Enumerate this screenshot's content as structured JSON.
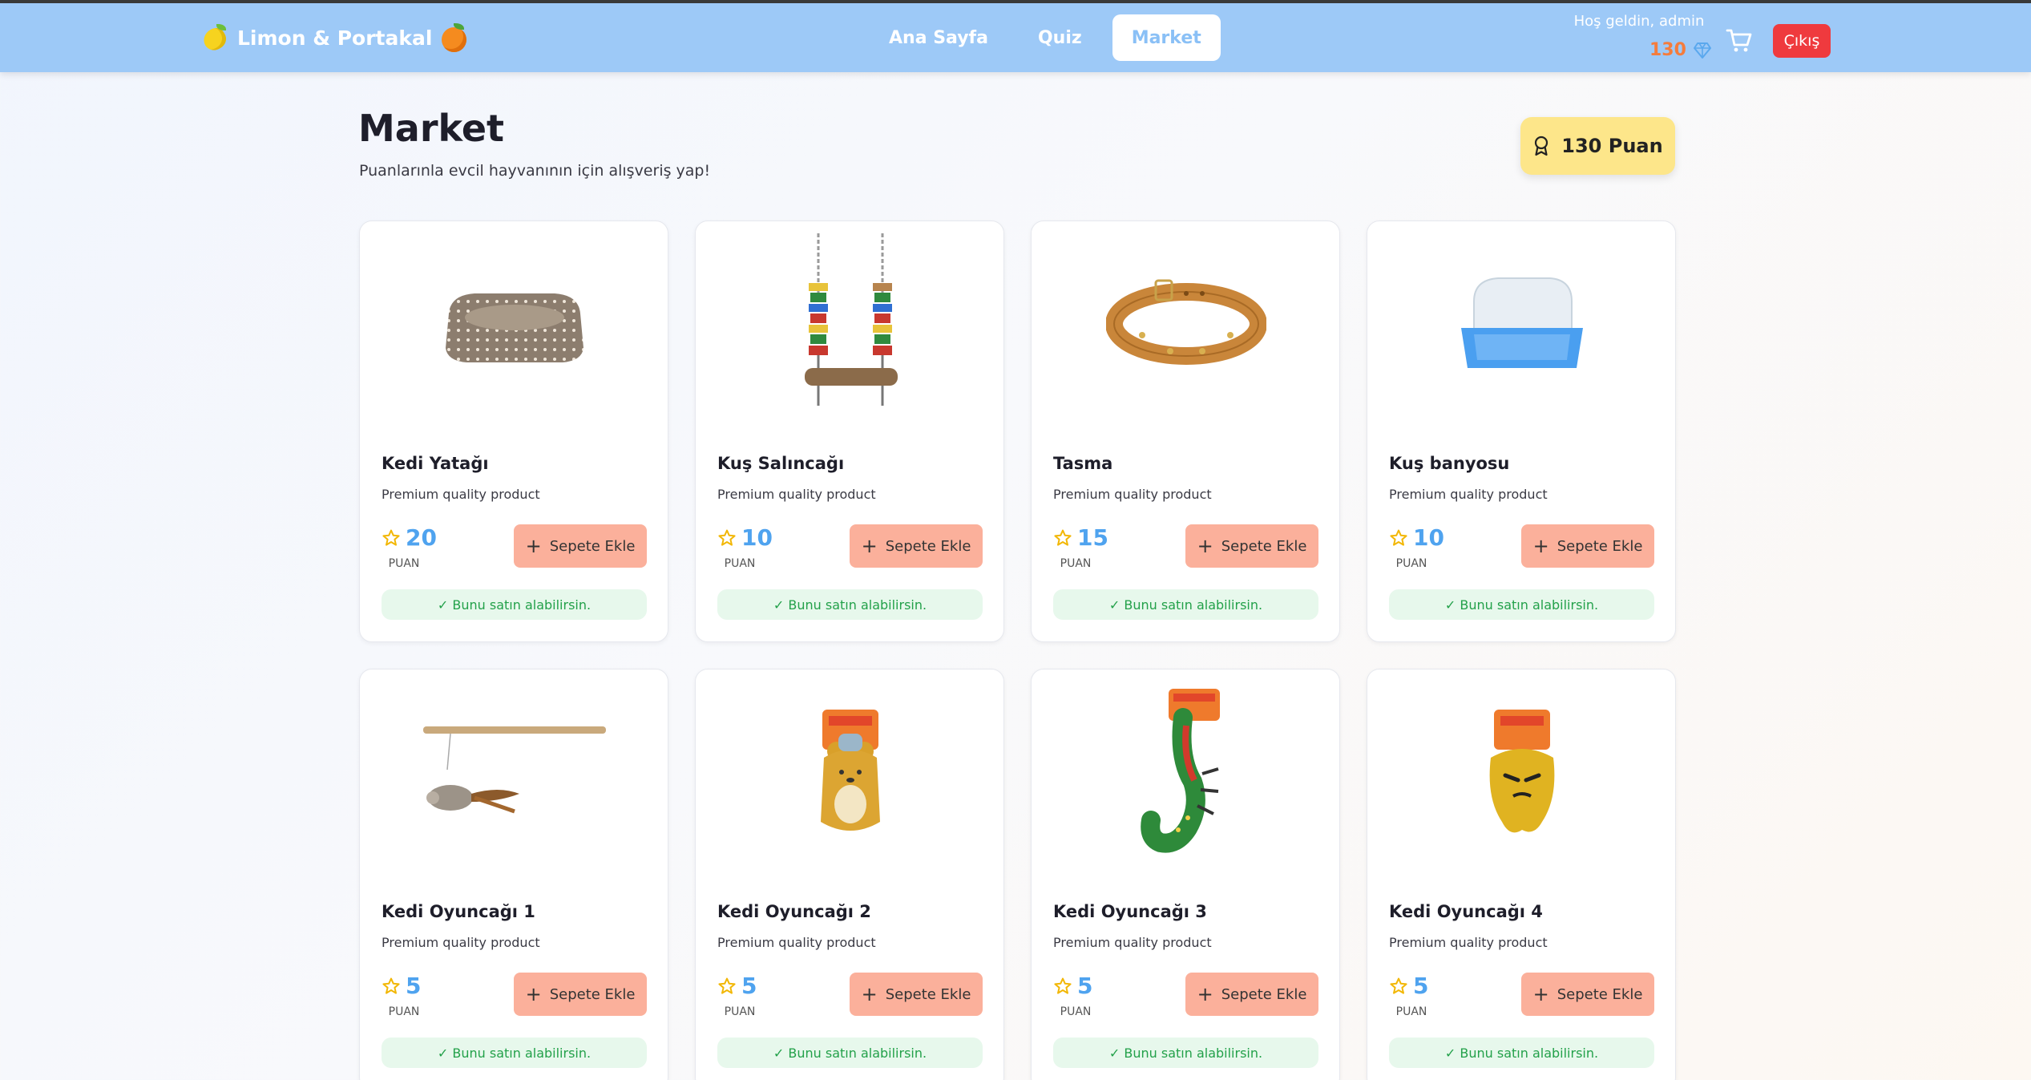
{
  "header": {
    "brand": "Limon & Portakal",
    "nav": [
      "Ana Sayfa",
      "Quiz",
      "Market"
    ],
    "active_nav": "Market",
    "welcome": "Hoş geldin, admin",
    "points": "130",
    "logout": "Çıkış"
  },
  "page": {
    "title": "Market",
    "subtitle": "Puanlarınla evcil hayvanının için alışveriş yap!",
    "balance": "130 Puan"
  },
  "products": [
    {
      "name": "Kedi Yatağı",
      "desc": "Premium quality product",
      "price": "20",
      "unit": "PUAN",
      "button": "Sepete Ekle",
      "status": "✓ Bunu satın alabilirsin.",
      "icon": "cat-bed-icon"
    },
    {
      "name": "Kuş Salıncağı",
      "desc": "Premium quality product",
      "price": "10",
      "unit": "PUAN",
      "button": "Sepete Ekle",
      "status": "✓ Bunu satın alabilirsin.",
      "icon": "bird-swing-icon"
    },
    {
      "name": "Tasma",
      "desc": "Premium quality product",
      "price": "15",
      "unit": "PUAN",
      "button": "Sepete Ekle",
      "status": "✓ Bunu satın alabilirsin.",
      "icon": "collar-icon"
    },
    {
      "name": "Kuş banyosu",
      "desc": "Premium quality product",
      "price": "10",
      "unit": "PUAN",
      "button": "Sepete Ekle",
      "status": "✓ Bunu satın alabilirsin.",
      "icon": "bird-bath-icon"
    },
    {
      "name": "Kedi Oyuncağı 1",
      "desc": "Premium quality product",
      "price": "5",
      "unit": "PUAN",
      "button": "Sepete Ekle",
      "status": "✓ Bunu satın alabilirsin.",
      "icon": "wand-mouse-toy-icon"
    },
    {
      "name": "Kedi Oyuncağı 2",
      "desc": "Premium quality product",
      "price": "5",
      "unit": "PUAN",
      "button": "Sepete Ekle",
      "status": "✓ Bunu satın alabilirsin.",
      "icon": "bear-toy-icon"
    },
    {
      "name": "Kedi Oyuncağı 3",
      "desc": "Premium quality product",
      "price": "5",
      "unit": "PUAN",
      "button": "Sepete Ekle",
      "status": "✓ Bunu satın alabilirsin.",
      "icon": "crocodile-toy-icon"
    },
    {
      "name": "Kedi Oyuncağı 4",
      "desc": "Premium quality product",
      "price": "5",
      "unit": "PUAN",
      "button": "Sepete Ekle",
      "status": "✓ Bunu satın alabilirsin.",
      "icon": "yellow-monster-toy-icon"
    }
  ],
  "colors": {
    "header": "#9dc9f7",
    "price": "#4fa3ef",
    "add_button": "#fbb09b",
    "logout": "#ef3a3e",
    "balance": "#fde68a",
    "status": "#23a14a"
  }
}
